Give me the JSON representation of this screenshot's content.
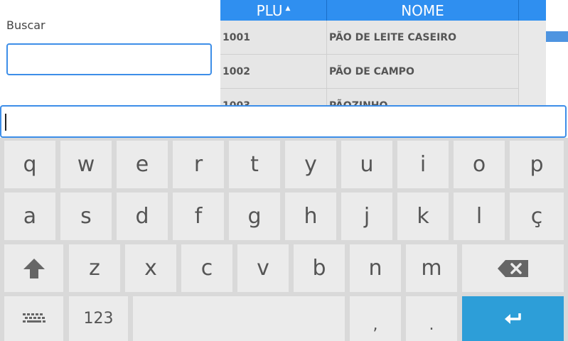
{
  "search": {
    "label": "Buscar",
    "value": ""
  },
  "table": {
    "headers": {
      "plu": "PLU",
      "nome": "NOME"
    },
    "rows": [
      {
        "plu": "1001",
        "nome": "PÃO DE LEITE CASEIRO"
      },
      {
        "plu": "1002",
        "nome": "PÃO DE CAMPO"
      },
      {
        "plu": "1003",
        "nome": "PÃOZINHO"
      }
    ]
  },
  "keyboard": {
    "row1": [
      "q",
      "w",
      "e",
      "r",
      "t",
      "y",
      "u",
      "i",
      "o",
      "p"
    ],
    "row2": [
      "a",
      "s",
      "d",
      "f",
      "g",
      "h",
      "j",
      "k",
      "l",
      "ç"
    ],
    "row3": [
      "z",
      "x",
      "c",
      "v",
      "b",
      "n",
      "m"
    ],
    "numbers_label": "123",
    "comma": ",",
    "period": "."
  },
  "colors": {
    "accent": "#2f8ff0",
    "enter": "#2d9ed8",
    "key": "#ebebeb",
    "keyboard_bg": "#d9d9d9"
  },
  "icons": {
    "shift": "shift-icon",
    "backspace": "backspace-icon",
    "keyboard": "keyboard-icon",
    "enter": "enter-icon"
  }
}
